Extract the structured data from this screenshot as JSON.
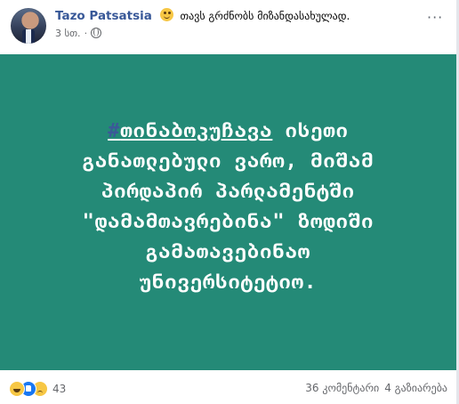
{
  "post": {
    "author": "Tazo Patsatsia",
    "feeling_text": "თავს გრძნობს მიზანდასახულად.",
    "time": "3 სთ.",
    "separator": "·",
    "more_glyph": "···",
    "image": {
      "background_color": "#248a77",
      "hashtag_symbol": "#",
      "hashtag_word": "თინაბოკუჩავა",
      "lines": [
        " ისეთი",
        "განათლებული ვარო, მიშამ",
        "პირდაპირ პარლამენტში",
        "\"დამამთავრებინა\" ზოდიში",
        "გამათავებინაო",
        "უნივერსიტეტიო."
      ]
    },
    "footer": {
      "reaction_icons": [
        "haha-icon",
        "like-icon",
        "sad-icon"
      ],
      "reaction_count": "43",
      "comments": "36 კომენტარი",
      "shares": "4 გაზიარება"
    }
  }
}
